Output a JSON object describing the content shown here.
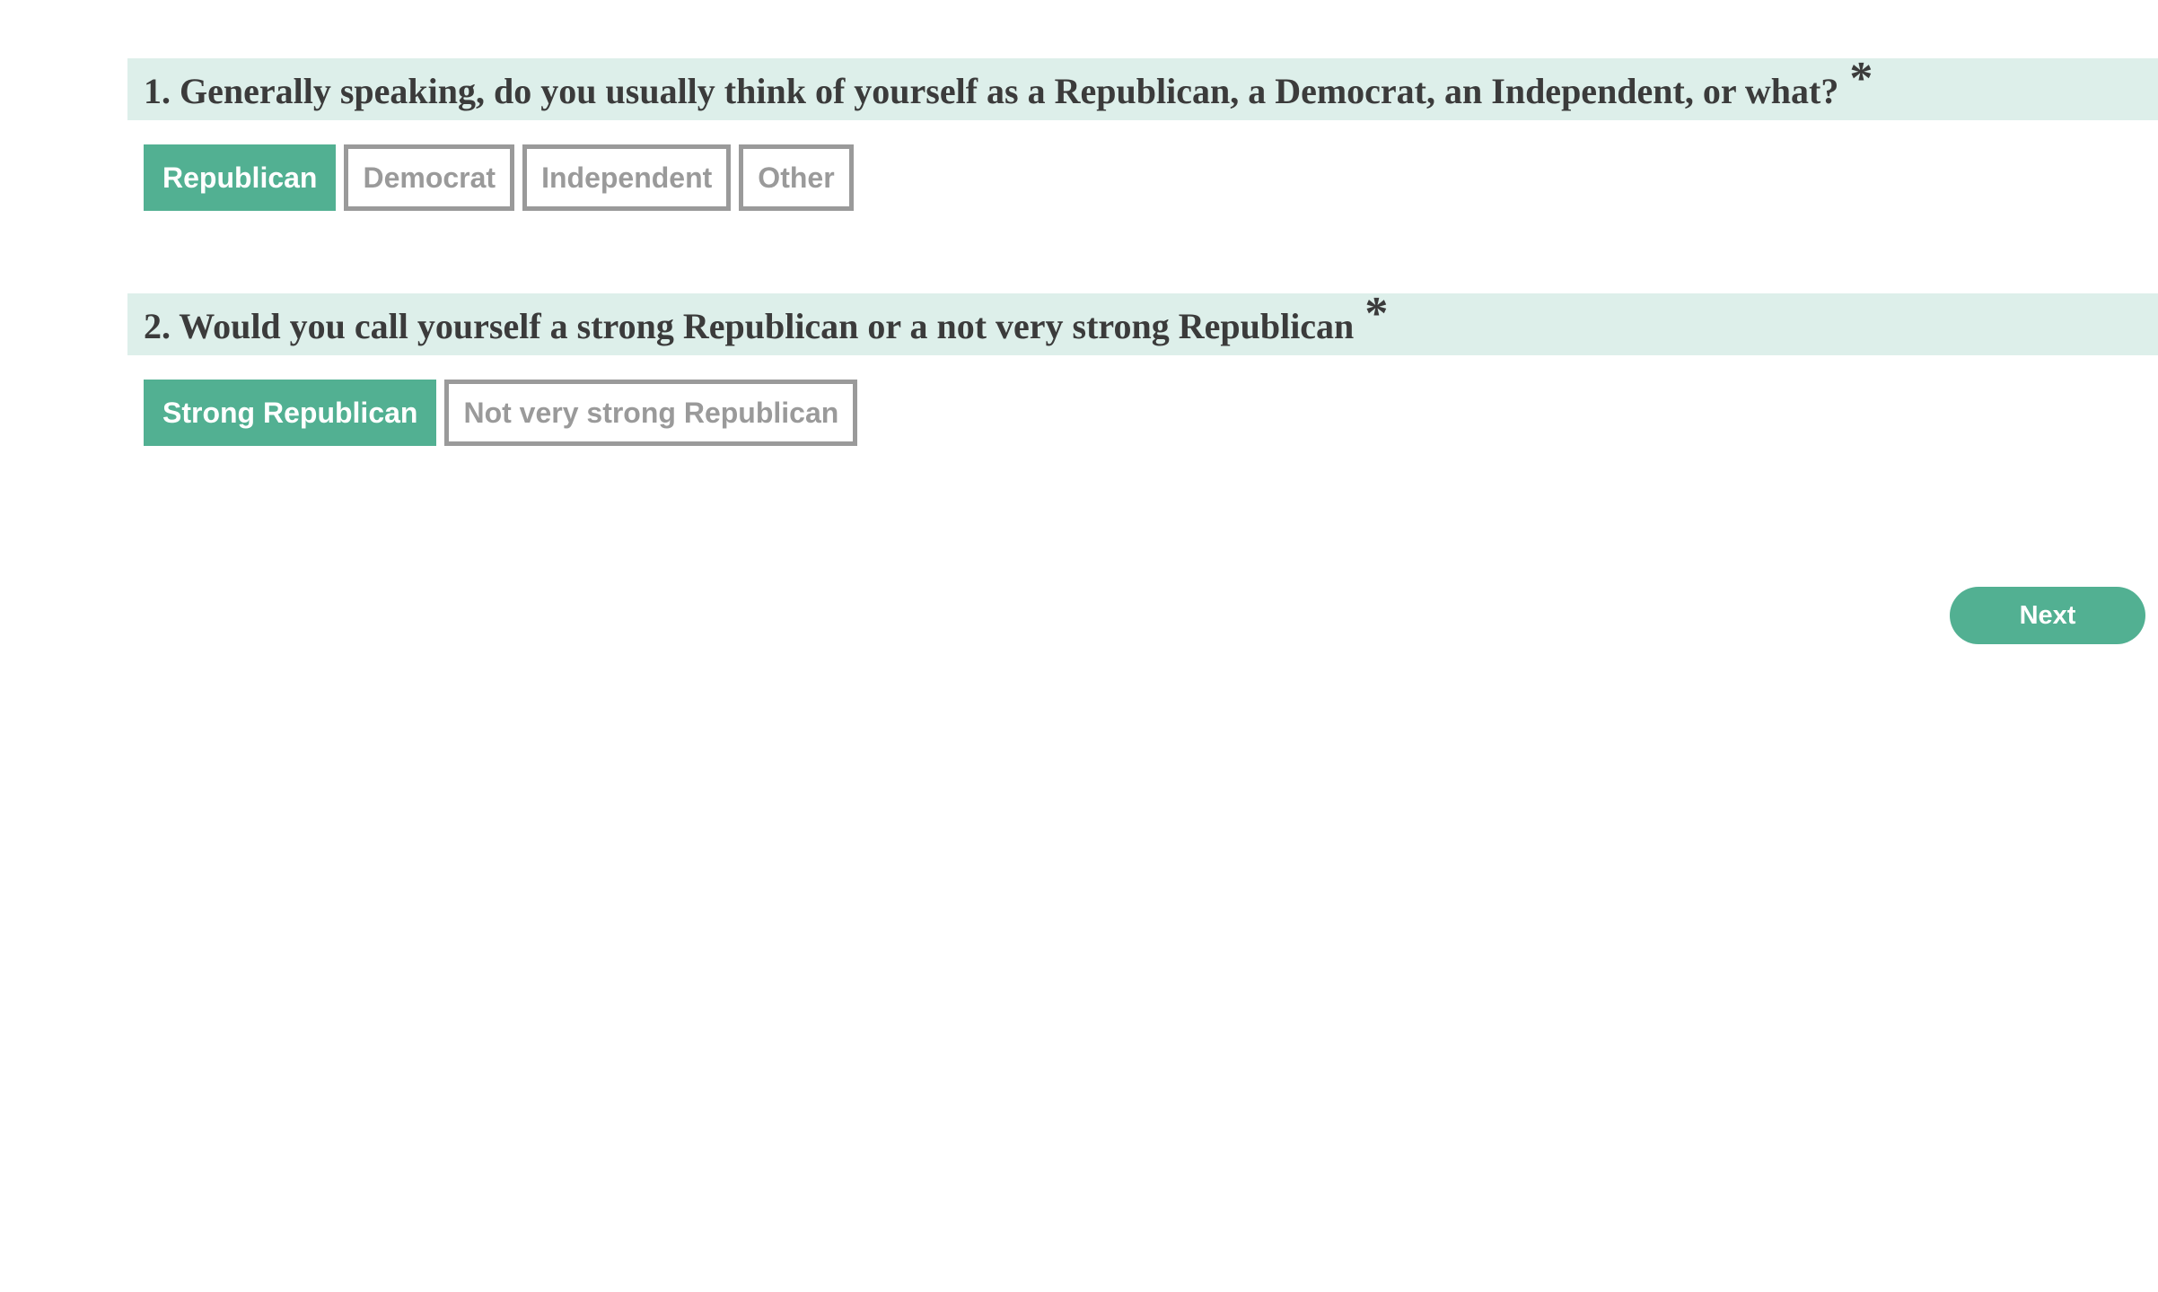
{
  "colors": {
    "accent": "#52b092",
    "header_background": "#ddefea",
    "unselected_border": "#9a9a9a",
    "question_text": "#3b3b3b"
  },
  "questions": [
    {
      "text": "1. Generally speaking, do you usually think of yourself as a Republican, a Democrat, an Independent, or what?",
      "required_marker": "*",
      "options": [
        {
          "label": "Republican",
          "selected": true
        },
        {
          "label": "Democrat",
          "selected": false
        },
        {
          "label": "Independent",
          "selected": false
        },
        {
          "label": "Other",
          "selected": false
        }
      ]
    },
    {
      "text": "2. Would you call yourself a strong Republican or a not very strong Republican",
      "required_marker": "*",
      "options": [
        {
          "label": "Strong Republican",
          "selected": true
        },
        {
          "label": "Not very strong Republican",
          "selected": false
        }
      ]
    }
  ],
  "navigation": {
    "next_label": "Next"
  }
}
